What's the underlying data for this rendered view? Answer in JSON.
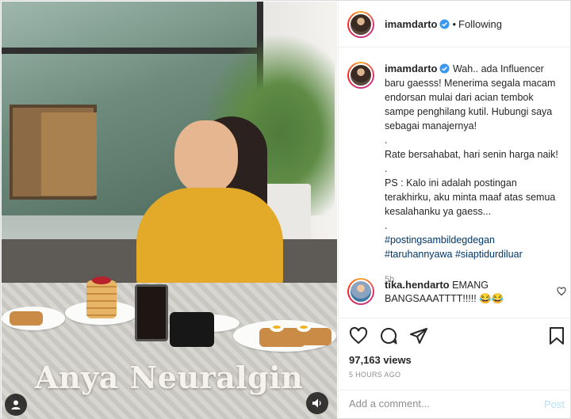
{
  "header": {
    "username": "imamdarto",
    "separator": "•",
    "follow_status": "Following"
  },
  "media": {
    "caption_overlay": "Anya Neuralgin"
  },
  "post": {
    "username": "imamdarto",
    "caption_lines": [
      "Wah.. ada Influencer baru gaesss! Menerima segala macam endorsan mulai dari acian tembok sampe penghilang kutil. Hubungi saya sebagai manajernya!",
      ".",
      "Rate bersahabat, hari senin harga naik!",
      ".",
      "PS : Kalo ini adalah postingan terakhirku, aku minta maaf atas semua kesalahanku ya gaess...",
      "."
    ],
    "hashtags": [
      "#postingsambildegdegan",
      "#taruhannyawa",
      "#siaptidurdiluar"
    ],
    "time": "5h"
  },
  "comment": {
    "username": "tika.hendarto",
    "text": "EMANG BANGSAAATTTT!!!!! 😂😂"
  },
  "stats": {
    "views": "97,163 views",
    "posted_ago": "5 HOURS AGO"
  },
  "composer": {
    "placeholder": "Add a comment...",
    "post_label": "Post"
  },
  "colors": {
    "verified": "#3897f0",
    "link": "#00376b",
    "muted": "#8e8e8e",
    "post_disabled": "#b2dffc"
  }
}
